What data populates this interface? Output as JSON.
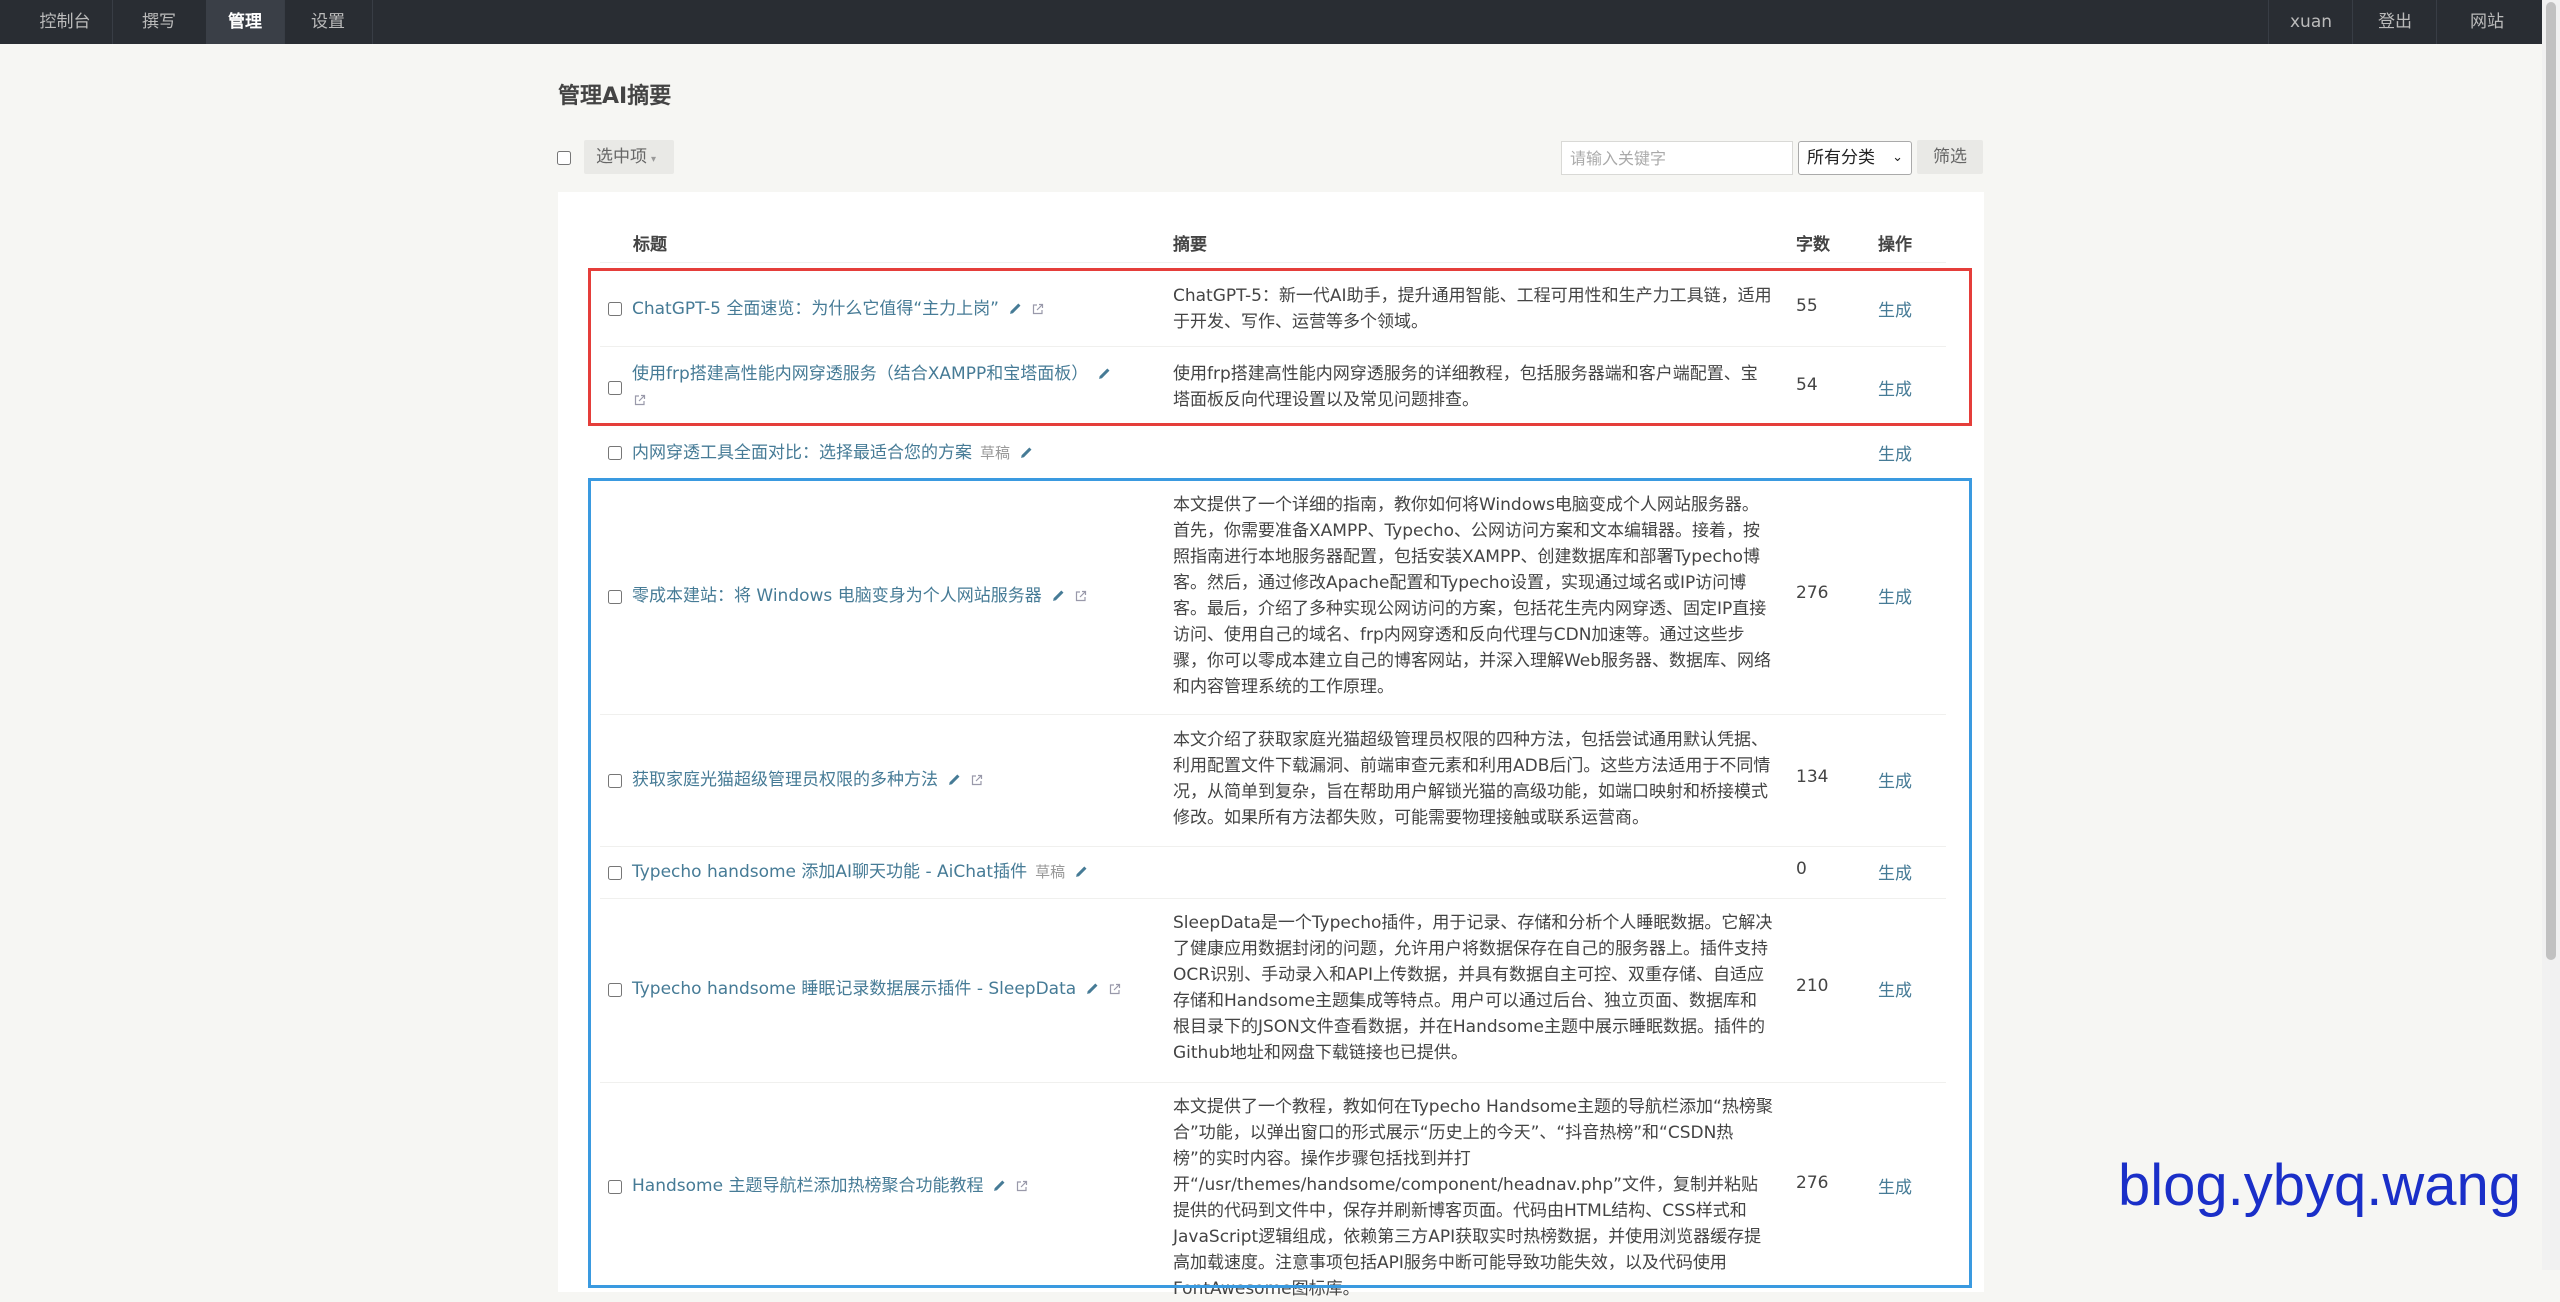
{
  "nav": {
    "left": [
      "控制台",
      "撰写",
      "管理",
      "设置"
    ],
    "right": [
      "xuan",
      "登出",
      "网站"
    ],
    "active_index": 2
  },
  "page_title": "管理AI摘要",
  "toolbar": {
    "selected_label": "选中项",
    "search_placeholder": "请输入关键字",
    "category_value": "所有分类",
    "filter_label": "筛选"
  },
  "table": {
    "headers": {
      "title": "标题",
      "summary": "摘要",
      "count": "字数",
      "action": "操作"
    },
    "rows": [
      {
        "title": "ChatGPT-5 全面速览：为什么它值得“主力上岗”",
        "draft": "",
        "summary": "ChatGPT-5：新一代AI助手，提升通用智能、工程可用性和生产力工具链，适用于开发、写作、运营等多个领域。",
        "count": "55",
        "action": "生成"
      },
      {
        "title": "使用frp搭建高性能内网穿透服务（结合XAMPP和宝塔面板）",
        "draft": "",
        "summary": "使用frp搭建高性能内网穿透服务的详细教程，包括服务器端和客户端配置、宝塔面板反向代理设置以及常见问题排查。",
        "count": "54",
        "action": "生成"
      },
      {
        "title": "内网穿透工具全面对比：选择最适合您的方案",
        "draft": "草稿",
        "summary": "",
        "count": "",
        "action": "生成"
      },
      {
        "title": "零成本建站：将 Windows 电脑变身为个人网站服务器",
        "draft": "",
        "summary": "本文提供了一个详细的指南，教你如何将Windows电脑变成个人网站服务器。首先，你需要准备XAMPP、Typecho、公网访问方案和文本编辑器。接着，按照指南进行本地服务器配置，包括安装XAMPP、创建数据库和部署Typecho博客。然后，通过修改Apache配置和Typecho设置，实现通过域名或IP访问博客。最后，介绍了多种实现公网访问的方案，包括花生壳内网穿透、固定IP直接访问、使用自己的域名、frp内网穿透和反向代理与CDN加速等。通过这些步骤，你可以零成本建立自己的博客网站，并深入理解Web服务器、数据库、网络和内容管理系统的工作原理。",
        "count": "276",
        "action": "生成"
      },
      {
        "title": "获取家庭光猫超级管理员权限的多种方法",
        "draft": "",
        "summary": "本文介绍了获取家庭光猫超级管理员权限的四种方法，包括尝试通用默认凭据、利用配置文件下载漏洞、前端审查元素和利用ADB后门。这些方法适用于不同情况，从简单到复杂，旨在帮助用户解锁光猫的高级功能，如端口映射和桥接模式修改。如果所有方法都失败，可能需要物理接触或联系运营商。",
        "count": "134",
        "action": "生成"
      },
      {
        "title": "Typecho handsome 添加AI聊天功能 - AiChat插件",
        "draft": "草稿",
        "summary": "",
        "count": "0",
        "action": "生成"
      },
      {
        "title": "Typecho handsome 睡眠记录数据展示插件 - SleepData",
        "draft": "",
        "summary": "SleepData是一个Typecho插件，用于记录、存储和分析个人睡眠数据。它解决了健康应用数据封闭的问题，允许用户将数据保存在自己的服务器上。插件支持OCR识别、手动录入和API上传数据，并具有数据自主可控、双重存储、自适应存储和Handsome主题集成等特点。用户可以通过后台、独立页面、数据库和根目录下的JSON文件查看数据，并在Handsome主题中展示睡眠数据。插件的Github地址和网盘下载链接也已提供。",
        "count": "210",
        "action": "生成"
      },
      {
        "title": "Handsome 主题导航栏添加热榜聚合功能教程",
        "draft": "",
        "summary": "本文提供了一个教程，教如何在Typecho Handsome主题的导航栏添加“热榜聚合”功能，以弹出窗口的形式展示“历史上的今天”、“抖音热榜”和“CSDN热榜”的实时内容。操作步骤包括找到并打开“/usr/themes/handsome/component/headnav.php”文件，复制并粘贴提供的代码到文件中，保存并刷新博客页面。代码由HTML结构、CSS样式和JavaScript逻辑组成，依赖第三方API获取实时热榜数据，并使用浏览器缓存提高加载速度。注意事项包括API服务中断可能导致功能失效，以及代码使用FontAwesome图标库。",
        "count": "276",
        "action": "生成"
      }
    ]
  },
  "watermark": "blog.ybyq.wang"
}
